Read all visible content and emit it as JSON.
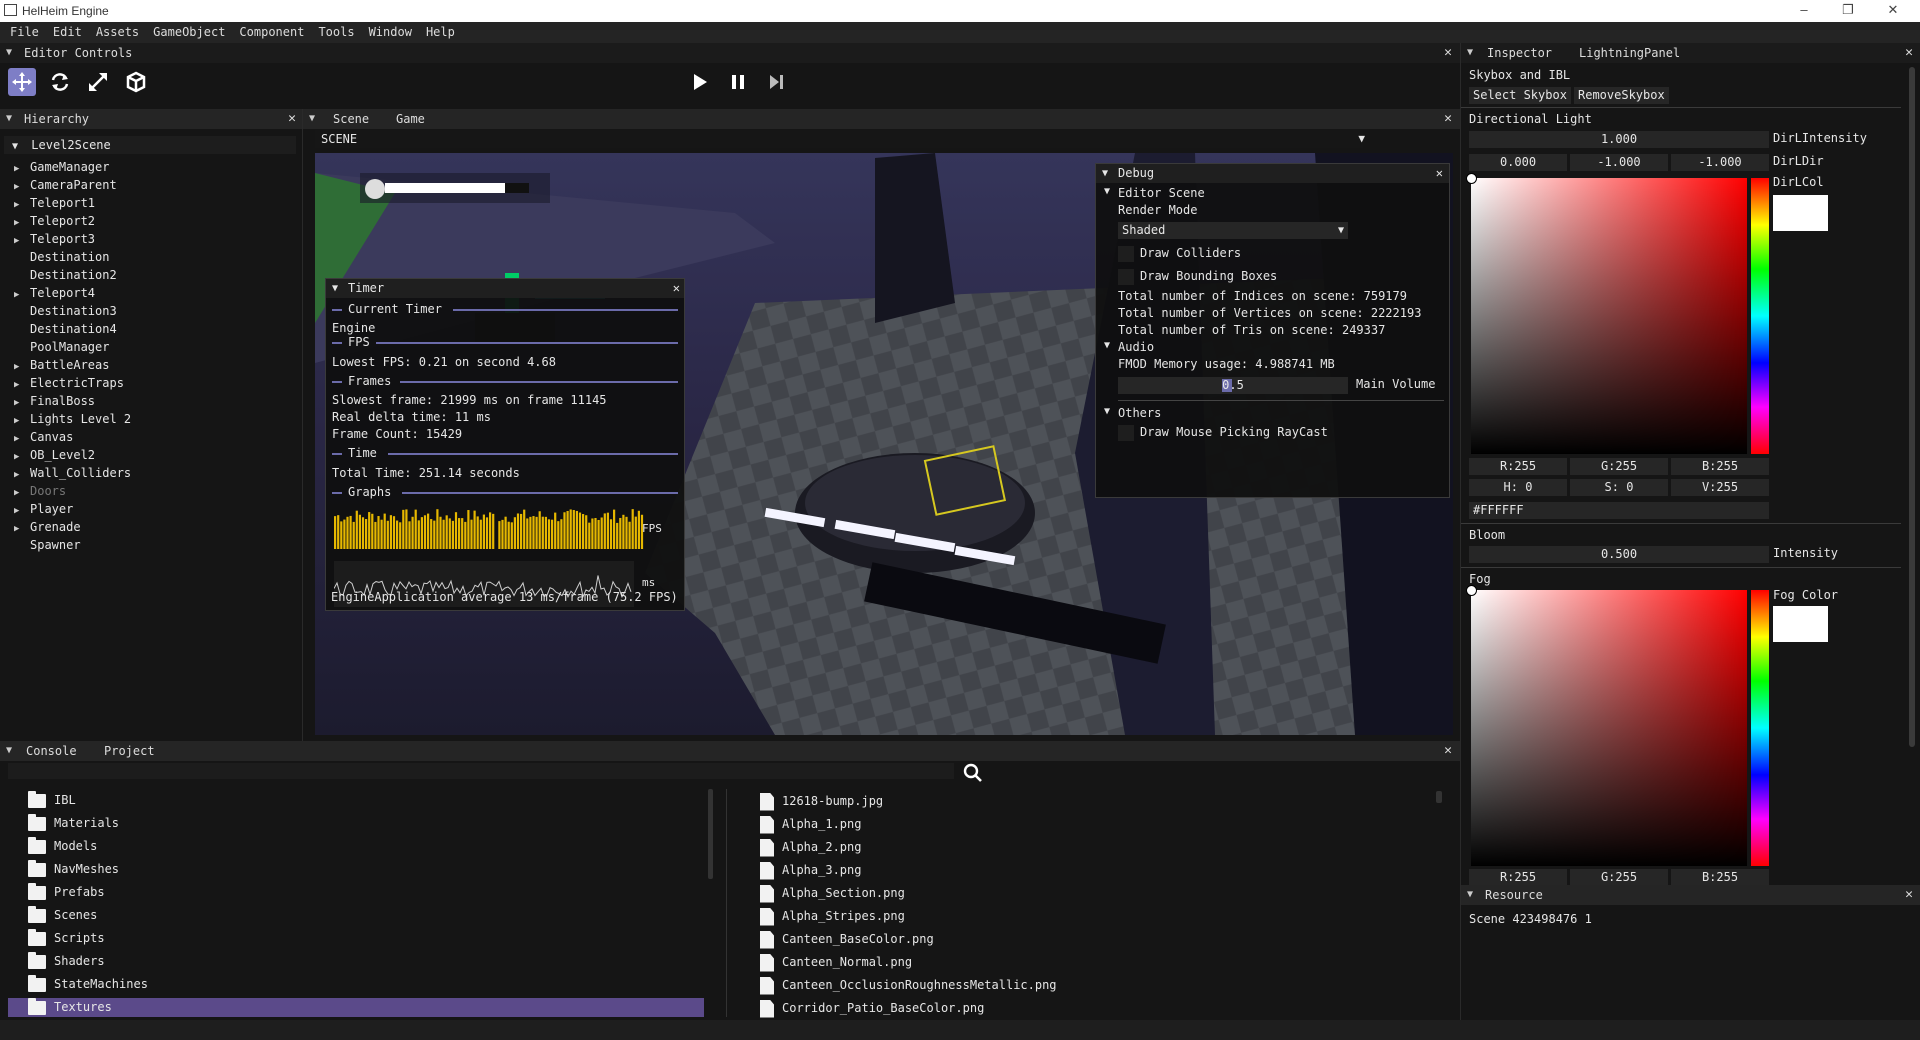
{
  "app": {
    "title": "HelHeim Engine"
  },
  "window_controls": {
    "minimize": "–",
    "maximize": "❐",
    "close": "✕"
  },
  "menu": [
    "File",
    "Edit",
    "Assets",
    "GameObject",
    "Component",
    "Tools",
    "Window",
    "Help"
  ],
  "editor_controls": {
    "title": "Editor Controls",
    "tools": [
      "move-icon",
      "rotate-icon",
      "scale-icon",
      "cube-icon"
    ],
    "playback": [
      "play-icon",
      "pause-icon",
      "step-icon"
    ]
  },
  "hierarchy": {
    "title": "Hierarchy",
    "root": "Level2Scene",
    "items": [
      {
        "label": "GameManager",
        "arrow": true,
        "dim": false
      },
      {
        "label": "CameraParent",
        "arrow": true,
        "dim": false
      },
      {
        "label": "Teleport1",
        "arrow": true,
        "dim": false
      },
      {
        "label": "Teleport2",
        "arrow": true,
        "dim": false
      },
      {
        "label": "Teleport3",
        "arrow": true,
        "dim": false
      },
      {
        "label": "Destination",
        "arrow": false,
        "dim": false
      },
      {
        "label": "Destination2",
        "arrow": false,
        "dim": false
      },
      {
        "label": "Teleport4",
        "arrow": true,
        "dim": false
      },
      {
        "label": "Destination3",
        "arrow": false,
        "dim": false
      },
      {
        "label": "Destination4",
        "arrow": false,
        "dim": false
      },
      {
        "label": "PoolManager",
        "arrow": false,
        "dim": false
      },
      {
        "label": "BattleAreas",
        "arrow": true,
        "dim": false
      },
      {
        "label": "ElectricTraps",
        "arrow": true,
        "dim": false
      },
      {
        "label": "FinalBoss",
        "arrow": true,
        "dim": false
      },
      {
        "label": "Lights Level 2",
        "arrow": true,
        "dim": false
      },
      {
        "label": "Canvas",
        "arrow": true,
        "dim": false
      },
      {
        "label": "OB_Level2",
        "arrow": true,
        "dim": false
      },
      {
        "label": "Wall_Colliders",
        "arrow": true,
        "dim": false
      },
      {
        "label": "Doors",
        "arrow": true,
        "dim": true
      },
      {
        "label": "Player",
        "arrow": true,
        "dim": false
      },
      {
        "label": "Grenade",
        "arrow": true,
        "dim": false
      },
      {
        "label": "Spawner",
        "arrow": false,
        "dim": false
      }
    ]
  },
  "scene": {
    "tabs": [
      "Scene",
      "Game"
    ],
    "dropdown_value": "SCENE"
  },
  "timer": {
    "title": "Timer",
    "current_timer": "Current Timer",
    "engine": "Engine",
    "fps_header": "FPS",
    "lowest_fps": "Lowest FPS: 0.21 on second 4.68",
    "frames_header": "Frames",
    "slowest_frame": "Slowest frame: 21999 ms on frame 11145",
    "real_delta": "Real delta time: 11 ms",
    "frame_count": "Frame Count: 15429",
    "time_header": "Time",
    "total_time": "Total Time: 251.14 seconds",
    "graphs_header": "Graphs",
    "fps_label": "FPS",
    "ms_label": "ms",
    "average": "EngineApplication average 13 ms/frame (75.2 FPS)"
  },
  "debug": {
    "title": "Debug",
    "editor_scene": "Editor Scene",
    "render_mode_label": "Render Mode",
    "render_mode_value": "Shaded",
    "draw_colliders": "Draw Colliders",
    "draw_bboxes": "Draw Bounding Boxes",
    "indices": "Total number of Indices on scene: 759179",
    "vertices": "Total number of Vertices on scene: 2222193",
    "tris": "Total number of Tris on scene: 249337",
    "audio": "Audio",
    "fmod": "FMOD Memory usage: 4.988741 MB",
    "volume_value": "0.5",
    "volume_label": "Main Volume",
    "others": "Others",
    "raycast": "Draw Mouse Picking RayCast"
  },
  "inspector": {
    "tabs": [
      "Inspector",
      "LightningPanel"
    ],
    "skybox_section": "Skybox and IBL",
    "select_skybox": "Select Skybox",
    "remove_skybox": "RemoveSkybox",
    "dir_light": "Directional Light",
    "dir_intensity_value": "1.000",
    "dir_intensity_label": "DirLIntensity",
    "dir_dir_values": [
      "0.000",
      "-1.000",
      "-1.000"
    ],
    "dir_dir_label": "DirLDir",
    "dir_col_label": "DirLCol",
    "rgb1": {
      "r": "R:255",
      "g": "G:255",
      "b": "B:255"
    },
    "hsv1": {
      "h": "H:  0",
      "s": "S:  0",
      "v": "V:255"
    },
    "hex1": "#FFFFFF",
    "bloom": "Bloom",
    "bloom_value": "0.500",
    "bloom_label": "Intensity",
    "fog": "Fog",
    "fog_color_label": "Fog Color",
    "rgb2": {
      "r": "R:255",
      "g": "G:255",
      "b": "B:255"
    },
    "colors": {
      "swatch": "#FFFFFF"
    }
  },
  "resource": {
    "title": "Resource",
    "text": "Scene 423498476 1"
  },
  "console": {
    "tabs": [
      "Console",
      "Project"
    ]
  },
  "project": {
    "folders": [
      "IBL",
      "Materials",
      "Models",
      "NavMeshes",
      "Prefabs",
      "Scenes",
      "Scripts",
      "Shaders",
      "StateMachines",
      "Textures"
    ],
    "selected_folder": "Textures",
    "files": [
      "12618-bump.jpg",
      "Alpha_1.png",
      "Alpha_2.png",
      "Alpha_3.png",
      "Alpha_Section.png",
      "Alpha_Stripes.png",
      "Canteen_BaseColor.png",
      "Canteen_Normal.png",
      "Canteen_OcclusionRoughnessMetallic.png",
      "Corridor_Patio_BaseColor.png"
    ]
  },
  "accent_colors": {
    "selection": "#5b4a8a",
    "tool_active": "#7e7ec6",
    "separator": "#6b6baa",
    "graph_bars": "#e6b800"
  }
}
